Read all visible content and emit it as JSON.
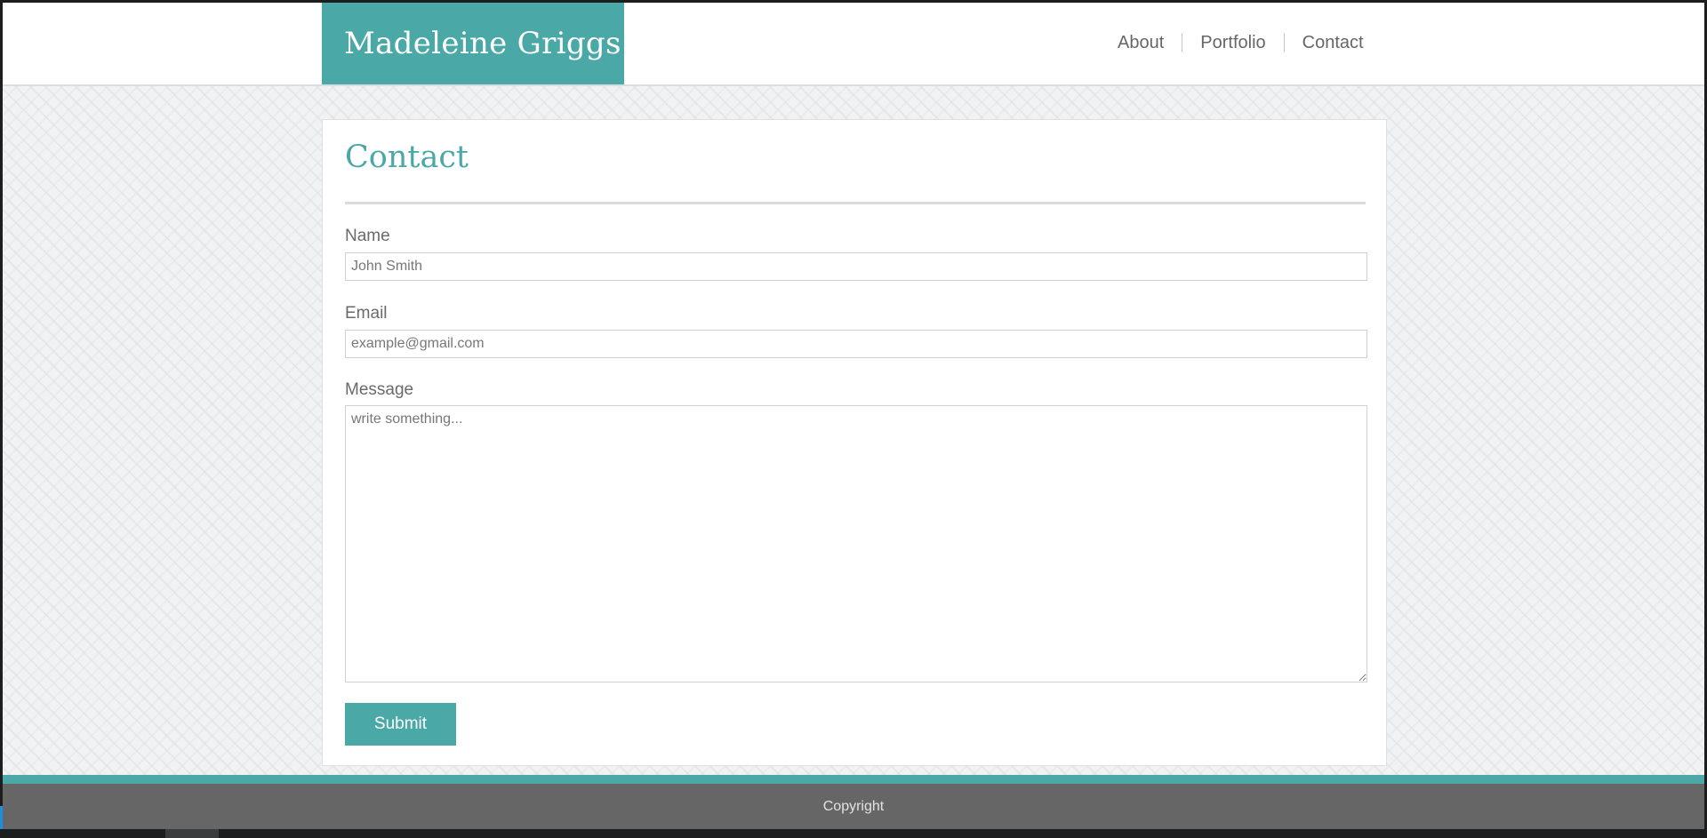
{
  "header": {
    "brand": "Madeleine Griggs",
    "nav": [
      {
        "label": "About"
      },
      {
        "label": "Portfolio"
      },
      {
        "label": "Contact"
      }
    ]
  },
  "main": {
    "title": "Contact",
    "form": {
      "name_label": "Name",
      "name_placeholder": "John Smith",
      "email_label": "Email",
      "email_placeholder": "example@gmail.com",
      "message_label": "Message",
      "message_placeholder": "write something...",
      "submit_label": "Submit"
    }
  },
  "footer": {
    "text": "Copyright"
  },
  "colors": {
    "accent": "#4aa8a6",
    "footer_bg": "#666666",
    "header_bg": "#ffffff"
  }
}
